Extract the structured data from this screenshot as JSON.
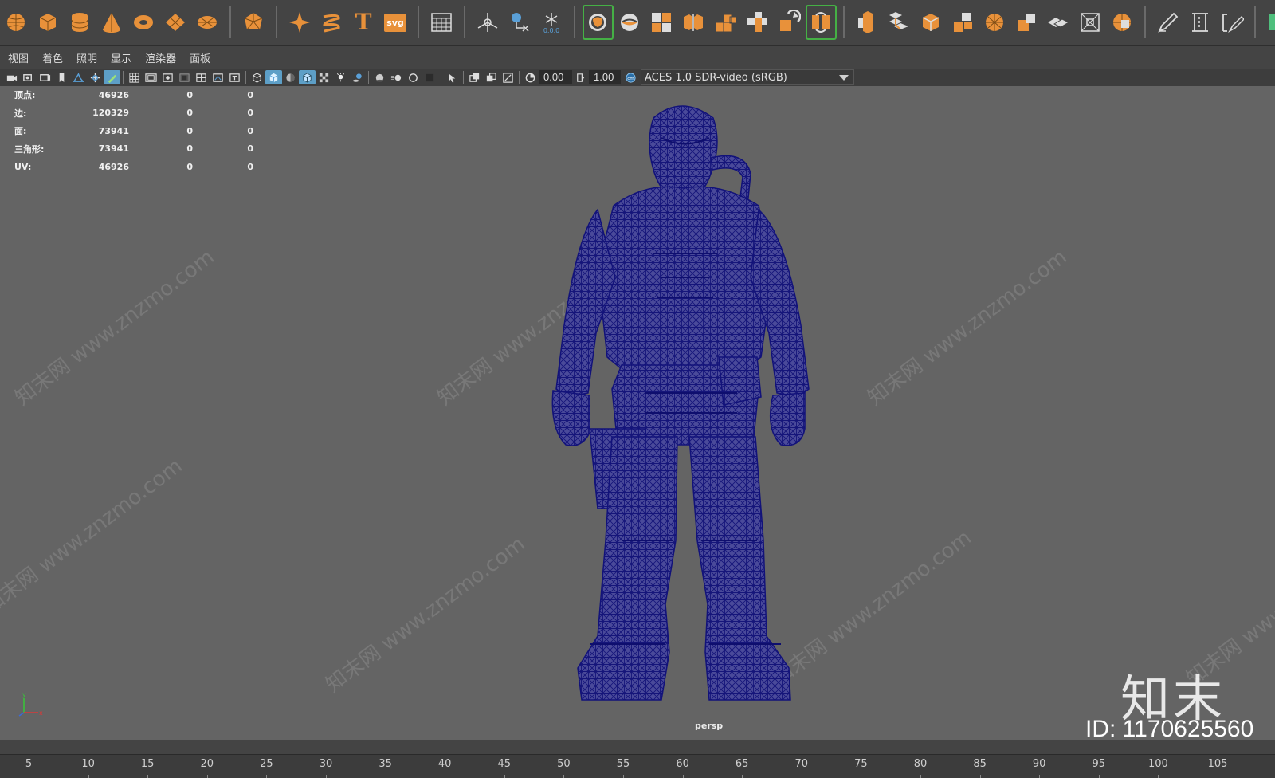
{
  "colors": {
    "icon": "#e8913a",
    "wire": "#1a1a8c",
    "viewport_bg": "#646464",
    "ui_bg": "#444444",
    "active": "#45b045"
  },
  "shelf": {
    "icons": [
      "sphere-icon",
      "cube-icon",
      "cylinder-icon",
      "cone-icon",
      "torus-icon",
      "plane-icon",
      "disc-icon",
      "sep",
      "platonic-icon",
      "sep",
      "sweep-icon",
      "helix-icon",
      "text-icon",
      "svg-icon",
      "sep",
      "grid-panel-icon",
      "sep",
      "locator-icon",
      "annotation-icon",
      "snowflake-icon",
      "sep",
      "select-camera-icon",
      "soccer-ball-icon",
      "combine-icon",
      "separate-icon",
      "extract-icon",
      "smooth-icon",
      "boolean-icon",
      "mirror-icon",
      "sep",
      "extrude-icon",
      "bridge-icon",
      "bevel-icon",
      "fill-hole-icon",
      "target-weld-icon",
      "merge-icon",
      "multicut-icon",
      "offset-loop-icon",
      "quad-draw-icon",
      "sep",
      "pen-icon",
      "insert-edge-icon",
      "connect-icon",
      "sep",
      "uv-editor-icon"
    ],
    "svg_label": "svg"
  },
  "menubar": {
    "items": [
      "视图",
      "着色",
      "照明",
      "显示",
      "渲染器",
      "面板"
    ]
  },
  "panel_toolbar": {
    "exposure": "0.00",
    "gamma": "1.00",
    "color_space": "ACES 1.0 SDR-video (sRGB)"
  },
  "hud": {
    "rows": [
      {
        "label": "顶点:",
        "v1": "46926",
        "v2": "0",
        "v3": "0"
      },
      {
        "label": "边:",
        "v1": "120329",
        "v2": "0",
        "v3": "0"
      },
      {
        "label": "面:",
        "v1": "73941",
        "v2": "0",
        "v3": "0"
      },
      {
        "label": "三角形:",
        "v1": "73941",
        "v2": "0",
        "v3": "0"
      },
      {
        "label": "UV:",
        "v1": "46926",
        "v2": "0",
        "v3": "0"
      }
    ]
  },
  "viewport": {
    "camera": "persp",
    "axis_x": "x",
    "axis_y": "y",
    "watermark_text": "知末网 www.znzmo.com",
    "logo_text": "知末",
    "id_text": "ID: 1170625560"
  },
  "timeline": {
    "ticks": [
      "5",
      "10",
      "15",
      "20",
      "25",
      "30",
      "35",
      "40",
      "45",
      "50",
      "55",
      "60",
      "65",
      "70",
      "75",
      "80",
      "85",
      "90",
      "95",
      "100",
      "105"
    ]
  }
}
